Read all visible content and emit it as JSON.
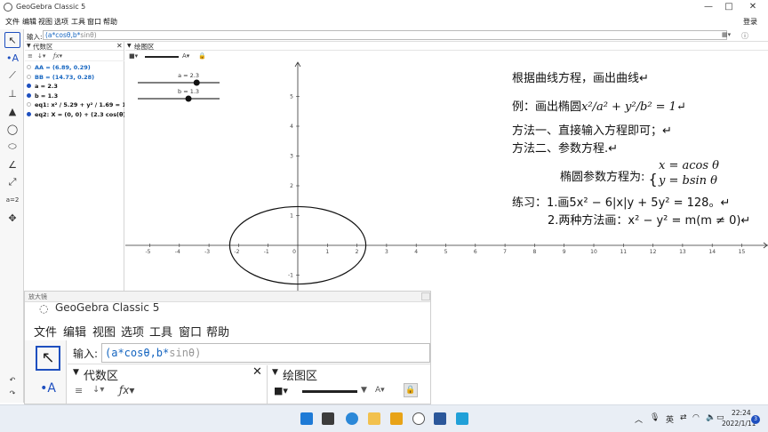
{
  "window": {
    "title": "GeoGebra Classic 5",
    "login": "登录",
    "controls": [
      "—",
      "□",
      "✕"
    ]
  },
  "menu": [
    "文件",
    "编辑",
    "视图",
    "选项",
    "工具",
    "窗口",
    "帮助"
  ],
  "input_bar": {
    "label": "输入:",
    "value_a": "(a",
    "value_b": "*cosθ,b*",
    "value_c": "sinθ)"
  },
  "algebra_view": {
    "title": "代数区",
    "items": [
      {
        "text": "AA = (6.89, 0.29)",
        "color": "#1565c0",
        "dot": false
      },
      {
        "text": "BB = (14.73, 0.28)",
        "color": "#1565c0",
        "dot": false
      },
      {
        "text": "a = 2.3",
        "color": "#111111",
        "dot": true,
        "dot_color": "#1e4fbf"
      },
      {
        "text": "b = 1.3",
        "color": "#111111",
        "dot": true,
        "dot_color": "#1e4fbf"
      },
      {
        "text": "eq1: x² / 5.29 + y² / 1.69 = 1",
        "color": "#111111",
        "dot": false
      },
      {
        "text": "eq2: X = (0, 0) + (2.3 cos(θ), 1.3",
        "color": "#111111",
        "dot": true,
        "dot_color": "#1e4fbf"
      }
    ]
  },
  "graphics_view": {
    "title": "绘图区",
    "sliders": [
      {
        "label": "a = 2.3",
        "value": 2.3,
        "fraction": 0.72
      },
      {
        "label": "b = 1.3",
        "value": 1.3,
        "fraction": 0.62
      }
    ],
    "x_ticks": [
      "-5",
      "-4",
      "-3",
      "-2",
      "-1",
      "0",
      "1",
      "2",
      "3",
      "4",
      "5",
      "6",
      "7",
      "8",
      "9",
      "10",
      "11",
      "12",
      "13",
      "14",
      "15"
    ],
    "y_ticks": [
      "5",
      "4",
      "3",
      "2",
      "1",
      "-1"
    ]
  },
  "notes": {
    "line1": "根据曲线方程，画出曲线↵",
    "line2_prefix": "例：画出椭圆",
    "line2_eq": "x²/a² + y²/b² = 1↵",
    "line3": "方法一、直接输入方程即可；↵",
    "line4": "方法二、参数方程.↵",
    "line5_prefix": "椭圆参数方程为:",
    "line5_eq1": "x = acos θ",
    "line5_eq2": "y = bsin θ",
    "line6": "练习：1.画5x² − 6|x|y + 5y² = 128。↵",
    "line7": "2.两种方法画：x² − y² = m(m ≠ 0)↵"
  },
  "zoom_window": {
    "title": "放大镜",
    "app_title": "GeoGebra Classic 5",
    "menu": [
      "文件",
      "编辑",
      "视图",
      "选项",
      "工具",
      "窗口",
      "帮助"
    ],
    "input_label": "输入:",
    "input_value_a": "(a",
    "input_value_b": "*cosθ,b*",
    "input_value_c": "sinθ)",
    "algebra_title": "代数区",
    "graphics_title": "绘图区"
  },
  "taskbar": {
    "lang": "英",
    "time": "22:24",
    "date": "2022/1/11",
    "badge": "3"
  },
  "chart_data": {
    "type": "scatter",
    "title": "",
    "xlabel": "",
    "ylabel": "",
    "xlim": [
      -5.8,
      15.2
    ],
    "ylim": [
      -1.4,
      6
    ],
    "grid": false,
    "curves": [
      {
        "name": "eq1",
        "kind": "ellipse",
        "a": 2.3,
        "b": 1.3,
        "center": [
          0,
          0
        ]
      }
    ]
  },
  "colors": {
    "accent": "#1e4fbf",
    "panel_border": "#d4d4d4",
    "taskbar": "#e9eef5"
  }
}
